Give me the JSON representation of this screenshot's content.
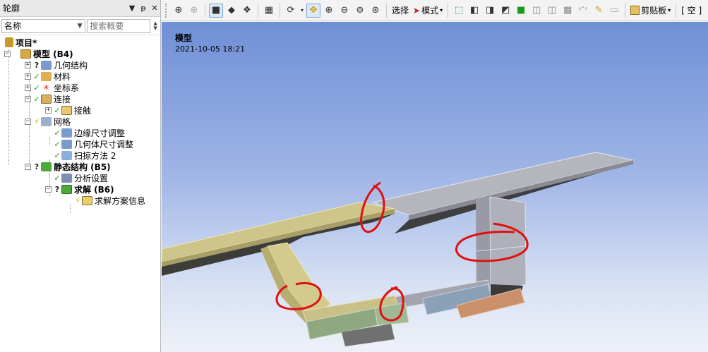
{
  "outline": {
    "title": "轮廓",
    "header_buttons": [
      "▼",
      "ᵽ",
      "✕"
    ],
    "name_select": "名称",
    "search_placeholder": "搜索概要",
    "tree": [
      {
        "label": "项目*",
        "bold": true,
        "status": "",
        "icon": "project-icon"
      },
      {
        "label": "模型 (B4)",
        "bold": true,
        "status": "",
        "icon": "model-icon"
      },
      {
        "label": "几何结构",
        "bold": false,
        "status": "?",
        "icon": "geometry-icon"
      },
      {
        "label": "材料",
        "bold": false,
        "status": "✓",
        "icon": "materials-icon"
      },
      {
        "label": "坐标系",
        "bold": false,
        "status": "✓",
        "icon": "coordinate-system-icon"
      },
      {
        "label": "连接",
        "bold": false,
        "status": "✓",
        "icon": "connections-icon"
      },
      {
        "label": "接触",
        "bold": false,
        "status": "✓",
        "icon": "contacts-icon"
      },
      {
        "label": "网格",
        "bold": false,
        "status": "⚡",
        "icon": "mesh-icon"
      },
      {
        "label": "边缘尺寸调整",
        "bold": false,
        "status": "✓",
        "icon": "edge-sizing-icon"
      },
      {
        "label": "几何体尺寸调整",
        "bold": false,
        "status": "✓",
        "icon": "body-sizing-icon"
      },
      {
        "label": "扫掠方法 2",
        "bold": false,
        "status": "✓",
        "icon": "sweep-method-icon"
      },
      {
        "label": "静态结构 (B5)",
        "bold": true,
        "status": "?",
        "icon": "static-structural-icon"
      },
      {
        "label": "分析设置",
        "bold": false,
        "status": "✓",
        "icon": "analysis-settings-icon"
      },
      {
        "label": "求解 (B6)",
        "bold": true,
        "status": "?",
        "icon": "solution-icon"
      },
      {
        "label": "求解方案信息",
        "bold": false,
        "status": "⚡",
        "icon": "solution-info-icon"
      }
    ]
  },
  "toolbar": {
    "select_label": "选择",
    "mode_label": "模式",
    "clipboard_label": "剪贴板",
    "empty_label": "[ 空 ]"
  },
  "viewport": {
    "title": "模型",
    "date": "2021-10-05 18:21"
  },
  "colors": {
    "body_yellow": "#cfc58a",
    "body_gray": "#a8a8b4",
    "body_green": "#8fa882",
    "body_blue": "#8a9fb8",
    "body_orange": "#c9906a",
    "annotation_red": "#e01010"
  }
}
